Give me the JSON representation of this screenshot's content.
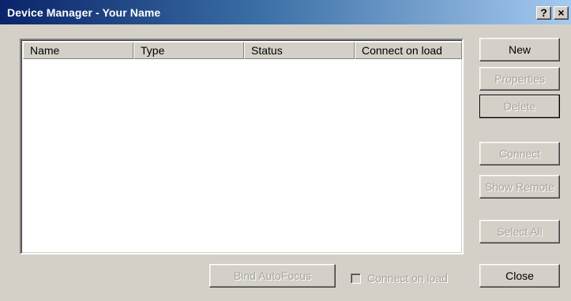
{
  "window": {
    "title": "Device Manager - Your Name",
    "help_label": "?",
    "close_label": "×"
  },
  "listview": {
    "columns": [
      "Name",
      "Type",
      "Status",
      "Connect on load"
    ],
    "rows": []
  },
  "buttons": {
    "new": "New",
    "properties": "Properties",
    "delete": "Delete",
    "connect": "Connect",
    "show_remote": "Show Remote",
    "select_all": "Select All",
    "close": "Close",
    "bind_autofocus": "Bind AutoFocus"
  },
  "options": {
    "connect_on_load_label": "Connect on load",
    "connect_on_load_checked": false
  },
  "colors": {
    "face": "#d4d0c8",
    "title_gradient_start": "#0a246a",
    "title_gradient_end": "#a6caf0",
    "disabled_text": "#a7a49d"
  }
}
